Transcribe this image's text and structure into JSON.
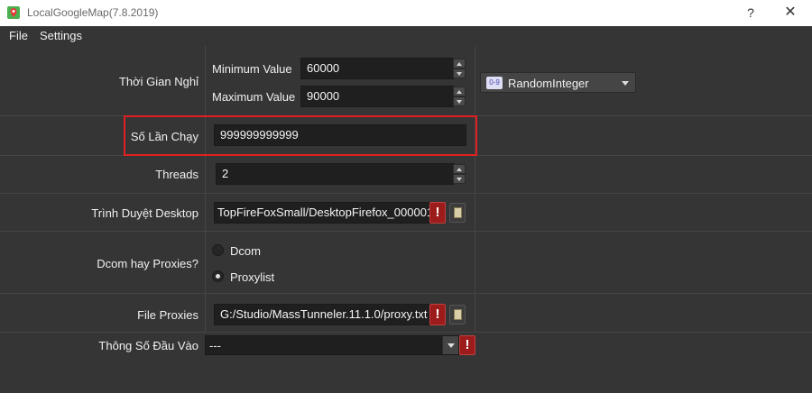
{
  "window": {
    "title": "LocalGoogleMap(7.8.2019)",
    "help": "?",
    "close": "✕"
  },
  "menu": {
    "file": "File",
    "settings": "Settings"
  },
  "rest": {
    "label": "Thời Gian Nghỉ",
    "min_label": "Minimum Value",
    "min_value": "60000",
    "max_label": "Maximum Value",
    "max_value": "90000",
    "mode_badge": "0-9",
    "mode_value": "RandomInteger"
  },
  "runs": {
    "label": "Số Lần Chạy",
    "value": "999999999999"
  },
  "threads": {
    "label": "Threads",
    "value": "2"
  },
  "browser": {
    "label": "Trình Duyệt Desktop",
    "value": "TopFireFoxSmall/DesktopFirefox_000001.",
    "error": "!"
  },
  "network": {
    "label": "Dcom hay Proxies?",
    "option_dcom": "Dcom",
    "option_proxylist": "Proxylist",
    "selected": "Proxylist"
  },
  "proxies": {
    "label": "File Proxies",
    "value": "G:/Studio/MassTunneler.11.1.0/proxy.txt",
    "error": "!"
  },
  "input": {
    "label": "Thông Số Đầu Vào",
    "value": "---",
    "error": "!"
  },
  "colors": {
    "background": "#353535",
    "field": "#1f1f1f",
    "highlight": "#e02020",
    "error": "#9c1b1b"
  }
}
